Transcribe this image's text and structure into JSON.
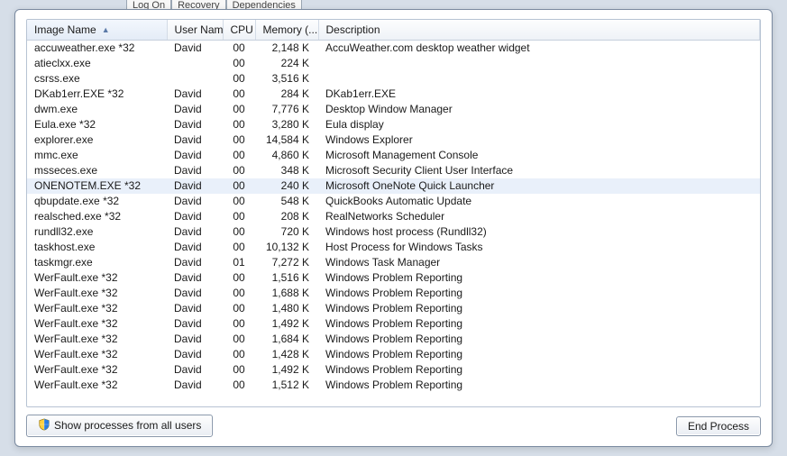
{
  "background_tabs": [
    "Log On",
    "Recovery",
    "Dependencies"
  ],
  "columns": [
    {
      "key": "image",
      "label": "Image Name",
      "sorted": true
    },
    {
      "key": "user",
      "label": "User Name"
    },
    {
      "key": "cpu",
      "label": "CPU"
    },
    {
      "key": "mem",
      "label": "Memory (..."
    },
    {
      "key": "desc",
      "label": "Description"
    }
  ],
  "rows": [
    {
      "image": "accuweather.exe *32",
      "user": "David",
      "cpu": "00",
      "mem": "2,148 K",
      "desc": "AccuWeather.com desktop weather widget"
    },
    {
      "image": "atieclxx.exe",
      "user": "",
      "cpu": "00",
      "mem": "224 K",
      "desc": ""
    },
    {
      "image": "csrss.exe",
      "user": "",
      "cpu": "00",
      "mem": "3,516 K",
      "desc": ""
    },
    {
      "image": "DKab1err.EXE *32",
      "user": "David",
      "cpu": "00",
      "mem": "284 K",
      "desc": "DKab1err.EXE"
    },
    {
      "image": "dwm.exe",
      "user": "David",
      "cpu": "00",
      "mem": "7,776 K",
      "desc": "Desktop Window Manager"
    },
    {
      "image": "Eula.exe *32",
      "user": "David",
      "cpu": "00",
      "mem": "3,280 K",
      "desc": "Eula display"
    },
    {
      "image": "explorer.exe",
      "user": "David",
      "cpu": "00",
      "mem": "14,584 K",
      "desc": "Windows Explorer"
    },
    {
      "image": "mmc.exe",
      "user": "David",
      "cpu": "00",
      "mem": "4,860 K",
      "desc": "Microsoft Management Console"
    },
    {
      "image": "msseces.exe",
      "user": "David",
      "cpu": "00",
      "mem": "348 K",
      "desc": "Microsoft Security Client User Interface"
    },
    {
      "image": "ONENOTEM.EXE *32",
      "user": "David",
      "cpu": "00",
      "mem": "240 K",
      "desc": "Microsoft OneNote Quick Launcher",
      "selected": true
    },
    {
      "image": "qbupdate.exe *32",
      "user": "David",
      "cpu": "00",
      "mem": "548 K",
      "desc": "QuickBooks Automatic Update"
    },
    {
      "image": "realsched.exe *32",
      "user": "David",
      "cpu": "00",
      "mem": "208 K",
      "desc": "RealNetworks Scheduler"
    },
    {
      "image": "rundll32.exe",
      "user": "David",
      "cpu": "00",
      "mem": "720 K",
      "desc": "Windows host process (Rundll32)"
    },
    {
      "image": "taskhost.exe",
      "user": "David",
      "cpu": "00",
      "mem": "10,132 K",
      "desc": "Host Process for Windows Tasks"
    },
    {
      "image": "taskmgr.exe",
      "user": "David",
      "cpu": "01",
      "mem": "7,272 K",
      "desc": "Windows Task Manager"
    },
    {
      "image": "WerFault.exe *32",
      "user": "David",
      "cpu": "00",
      "mem": "1,516 K",
      "desc": "Windows Problem Reporting"
    },
    {
      "image": "WerFault.exe *32",
      "user": "David",
      "cpu": "00",
      "mem": "1,688 K",
      "desc": "Windows Problem Reporting"
    },
    {
      "image": "WerFault.exe *32",
      "user": "David",
      "cpu": "00",
      "mem": "1,480 K",
      "desc": "Windows Problem Reporting"
    },
    {
      "image": "WerFault.exe *32",
      "user": "David",
      "cpu": "00",
      "mem": "1,492 K",
      "desc": "Windows Problem Reporting"
    },
    {
      "image": "WerFault.exe *32",
      "user": "David",
      "cpu": "00",
      "mem": "1,684 K",
      "desc": "Windows Problem Reporting"
    },
    {
      "image": "WerFault.exe *32",
      "user": "David",
      "cpu": "00",
      "mem": "1,428 K",
      "desc": "Windows Problem Reporting"
    },
    {
      "image": "WerFault.exe *32",
      "user": "David",
      "cpu": "00",
      "mem": "1,492 K",
      "desc": "Windows Problem Reporting"
    },
    {
      "image": "WerFault.exe *32",
      "user": "David",
      "cpu": "00",
      "mem": "1,512 K",
      "desc": "Windows Problem Reporting"
    }
  ],
  "footer": {
    "show_all_label": "Show processes from all users",
    "end_process_label": "End Process"
  }
}
